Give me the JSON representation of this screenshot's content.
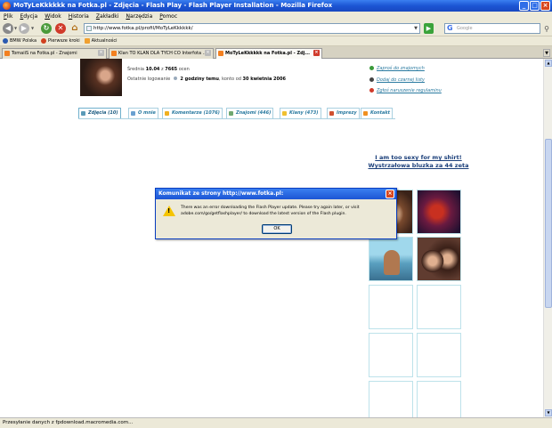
{
  "window": {
    "title": "MoTyLeKkkkkk na Fotka.pl - Zdjęcia - Flash Play - Flash Player Installation - Mozilla Firefox"
  },
  "menu": [
    "Plik",
    "Edycja",
    "Widok",
    "Historia",
    "Zakładki",
    "Narzędzia",
    "Pomoc"
  ],
  "toolbar": {
    "url": "http://www.fotka.pl/profil/MoTyLeKkkkkk/",
    "search_placeholder": "Google"
  },
  "bookmarks": [
    "BMW Polska",
    "Pierwsze kroki",
    "Aktualności"
  ],
  "tabs": [
    {
      "label": "TomaiiS na Fotka.pl - Znajomi"
    },
    {
      "label": "Klan TO KLAN DLA TYCH CO Interfota ..."
    },
    {
      "label": "MoTyLeKkkkkk na Fotka.pl - Zdj..."
    }
  ],
  "profile": {
    "rating_prefix": "Średnia",
    "rating_value": "10.04",
    "rating_mid": "z",
    "rating_count": "7665",
    "rating_suffix": "ocen",
    "last_login_label": "Ostatnie logowanie",
    "last_login_value": "2 godziny temu",
    "account_label": ", konto od",
    "account_value": "30 kwietnia 2006"
  },
  "actions": [
    "Zaproś do znajomych",
    "Dodaj do czarnej listy",
    "Zgłoś naruszenie regulaminu"
  ],
  "profile_tabs": [
    {
      "label": "Zdjęcia (10)"
    },
    {
      "label": "O mnie"
    },
    {
      "label": "Komentarze (1076)"
    },
    {
      "label": "Znajomi (446)"
    },
    {
      "label": "Klany (473)"
    },
    {
      "label": "Imprezy"
    },
    {
      "label": "Kontakt"
    }
  ],
  "promo": {
    "line1": "I am too sexy for my shirt!",
    "line2": "Wystrzałowa bluzka za 44 zeta"
  },
  "dialog": {
    "title": "Komunikat ze strony http://www.fotka.pl:",
    "message": "There was an error downloading the Flash Player update. Please try again later, or visit adobe.com/go/getflashplayer/ to download the latest version of the Flash plugin.",
    "ok_label": "OK"
  },
  "status": "Przesyłanie danych z fpdownload.macromedia.com...",
  "colors": {
    "link": "#2a7aa0",
    "promo": "#1b3f7a",
    "titlebar": "#1c55d4"
  }
}
